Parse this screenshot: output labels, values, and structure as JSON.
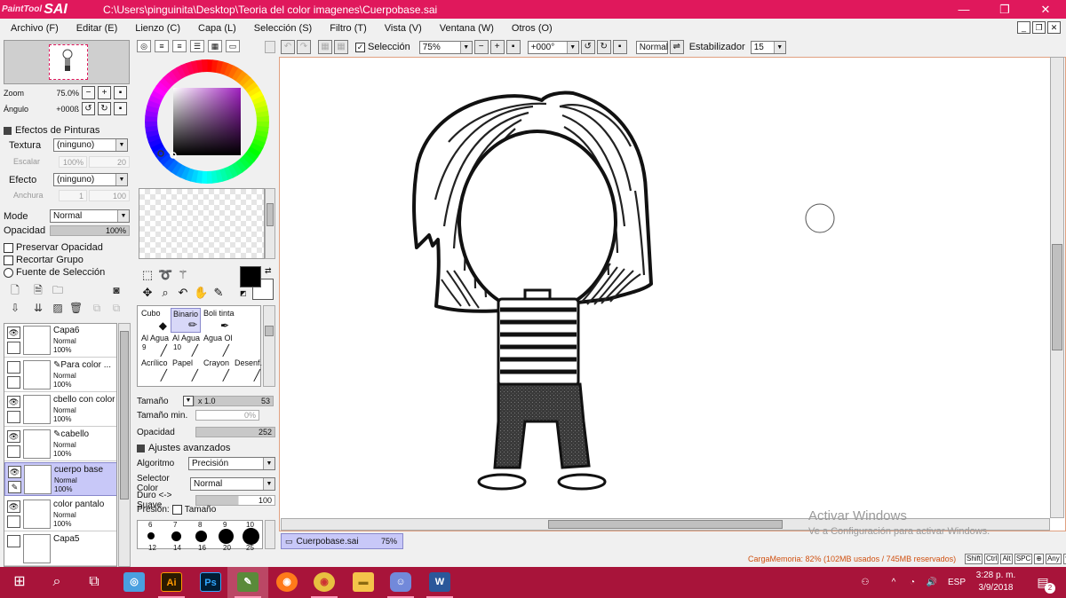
{
  "app": {
    "logo_top": "PaintTool",
    "logo_main": "SAI",
    "title": "C:\\Users\\pinguinita\\Desktop\\Teoria del color imagenes\\Cuerpobase.sai",
    "minimize": "—",
    "maximize": "❐",
    "close": "✕"
  },
  "menu": [
    "Archivo (F)",
    "Editar (E)",
    "Lienzo (C)",
    "Capa (L)",
    "Selección (S)",
    "Filtro (T)",
    "Vista (V)",
    "Ventana (W)",
    "Otros (O)"
  ],
  "navigator": {
    "zoom_label": "Zoom",
    "zoom_value": "75.0%",
    "angle_label": "Ángulo",
    "angle_value": "+000ß"
  },
  "effects": {
    "header": "Efectos de Pinturas",
    "texture_label": "Textura",
    "texture_value": "(ninguno)",
    "scale_label": "Escalar",
    "scale_value": "100%",
    "scale_num": "20",
    "effect_label": "Efecto",
    "effect_value": "(ninguno)",
    "width_label": "Anchura",
    "width_value": "1",
    "width_num": "100"
  },
  "layer_props": {
    "mode_label": "Mode",
    "mode_value": "Normal",
    "opacity_label": "Opacidad",
    "opacity_value": "100%",
    "opacity_fraction": 1.0,
    "preserve_opacity": "Preservar Opacidad",
    "clip_group": "Recortar Grupo",
    "selection_source": "Fuente de Selección"
  },
  "layers": [
    {
      "name": "Capa6",
      "mode": "Normal",
      "opacity": "100%",
      "selected": false,
      "visible": true,
      "pen": false
    },
    {
      "name": "Para color ...",
      "mode": "Normal",
      "opacity": "100%",
      "selected": false,
      "visible": false,
      "pen": true
    },
    {
      "name": "cbello con color",
      "mode": "Normal",
      "opacity": "100%",
      "selected": false,
      "visible": true,
      "pen": false
    },
    {
      "name": "cabello",
      "mode": "Normal",
      "opacity": "100%",
      "selected": false,
      "visible": true,
      "pen": true
    },
    {
      "name": "cuerpo base",
      "mode": "Normal",
      "opacity": "100%",
      "selected": true,
      "visible": true,
      "pen": false
    },
    {
      "name": "color pantalo",
      "mode": "Normal",
      "opacity": "100%",
      "selected": false,
      "visible": true,
      "pen": false
    },
    {
      "name": "Capa5",
      "mode": "",
      "opacity": "",
      "selected": false,
      "visible": false,
      "pen": false
    }
  ],
  "brushes": [
    {
      "label": "Cubo",
      "size": "",
      "icon": "🪣",
      "selected": false
    },
    {
      "label": "Binario",
      "size": "",
      "icon": "✏",
      "selected": true
    },
    {
      "label": "Boli tinta",
      "size": "",
      "icon": "✒",
      "selected": false
    },
    {
      "label": "Al Agua",
      "size": "9",
      "icon": "🖌",
      "selected": false
    },
    {
      "label": "Al Agua",
      "size": "10",
      "icon": "🖌",
      "selected": false
    },
    {
      "label": "Agua Ol",
      "size": "",
      "icon": "🖌",
      "selected": false
    },
    {
      "label": "Acrílico",
      "size": "",
      "icon": "🖌",
      "selected": false
    },
    {
      "label": "Papel",
      "size": "",
      "icon": "🖌",
      "selected": false
    },
    {
      "label": "Crayon",
      "size": "",
      "icon": "🖍",
      "selected": false
    },
    {
      "label": "Desenf.",
      "size": "",
      "icon": "💧",
      "selected": false
    }
  ],
  "brush_params": {
    "size_label": "Tamaño",
    "size_mult": "x 1.0",
    "size_value": "53",
    "min_size_label": "Tamaño min.",
    "min_size_value": "0%",
    "opacity_label": "Opacidad",
    "opacity_value": "252",
    "advanced_label": "Ajustes avanzados",
    "algorithm_label": "Algoritmo",
    "algorithm_value": "Precisión",
    "color_selector_label": "Selector Color",
    "color_selector_value": "Normal",
    "hard_soft_label": "Duro <-> Suave",
    "hard_soft_value": "100",
    "pressure_label": "Presión:",
    "pressure_size_label": "Tamaño"
  },
  "dot_sizes": [
    "6",
    "7",
    "8",
    "9",
    "10",
    "12",
    "14",
    "16",
    "20",
    "25"
  ],
  "canvas_toolbar": {
    "selection_label": "Selección",
    "zoom_value": "75%",
    "rotation_value": "+000°",
    "blend_value": "Normal",
    "stabilizer_label": "Estabilizador",
    "stabilizer_value": "15"
  },
  "document_tab": {
    "name": "Cuerpobase.sai",
    "zoom": "75%"
  },
  "watermark": {
    "line1": "Activar Windows",
    "line2": "Ve a Configuración para activar Windows."
  },
  "status": {
    "memory": "CargaMemoria: 82% (102MB usados / 745MB reservados)",
    "keys": [
      "Shift",
      "Ctrl",
      "Alt",
      "SPC",
      "⊕",
      "Any",
      "✎"
    ]
  },
  "taskbar": {
    "apps": [
      {
        "name": "Photoshop",
        "icon": "Ps"
      },
      {
        "name": "Illustrator",
        "icon": "Ai"
      },
      {
        "name": "Word",
        "icon": "W"
      }
    ],
    "lang": "ESP",
    "time": "3:28 p. m.",
    "date": "3/9/2018",
    "notifications": "2"
  },
  "colors": {
    "accent": "#e0185c",
    "taskbar": "#a8143a",
    "selection": "#c8c8f8"
  }
}
